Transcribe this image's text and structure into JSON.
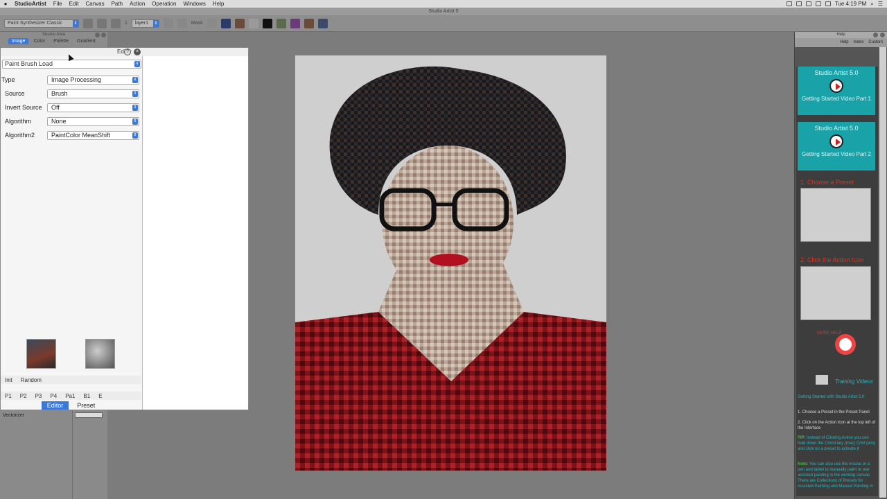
{
  "menubar": {
    "app": "StudioArtist",
    "items": [
      "File",
      "Edit",
      "Canvas",
      "Path",
      "Action",
      "Operation",
      "Windows",
      "Help"
    ],
    "clock": "Tue 4:19 PM"
  },
  "window": {
    "title": "Studio Artist 5"
  },
  "toolbar": {
    "preset_select": "Paint Synthesizer Classic",
    "layer_num": "1",
    "layer_select": "layer1",
    "mask_label": "Mask"
  },
  "source_area": {
    "title": "Source Area",
    "tabs": [
      "Image",
      "Color",
      "Palette",
      "Gradient"
    ],
    "active_tab": "Image"
  },
  "editor": {
    "title": "Editor",
    "main_select": "Paint Brush Load",
    "params": [
      {
        "label": "Type",
        "value": "Image Processing"
      },
      {
        "label": "Source",
        "value": "Brush"
      },
      {
        "label": "Invert Source",
        "value": "Off"
      },
      {
        "label": "Algorithm",
        "value": "None"
      },
      {
        "label": "Algorithm2",
        "value": "PaintColor MeanShift"
      }
    ],
    "init_row": [
      "Init",
      "Random"
    ],
    "preset_row": [
      "P1",
      "P2",
      "P3",
      "P4",
      "Pa1",
      "B1",
      "E"
    ],
    "tabs": [
      "Editor",
      "Preset"
    ],
    "active_tab": "Editor"
  },
  "vectorizer": {
    "label": "Vectorizer"
  },
  "help": {
    "title": "Help",
    "nav": [
      "Help",
      "Index",
      "Custom"
    ],
    "videos": [
      {
        "title": "Studio Artist 5.0",
        "subtitle": "Getting Started Video Part 1"
      },
      {
        "title": "Studio Artist 5.0",
        "subtitle": "Getting Started Video Part 2"
      }
    ],
    "steps": [
      {
        "title": "1. Choose a Preset"
      },
      {
        "title": "2. Click the Action Icon"
      }
    ],
    "more_help": "MORE HELP",
    "training": "Training Videos",
    "text": {
      "heading": "Getting Started with Studio Artist 5.0",
      "line1": "1. Choose a Preset in the Preset Panel",
      "line2": "2. Click on the Action Icon at the top left of the Interface",
      "tip_label": "TIP:",
      "tip": "Instead of Clicking Action you can hold down the Cmnd key (mac) Cntrl (win) and click on a preset to activate it",
      "note_label": "Note:",
      "note": "You can also use the mouse or a pen and tablet to manually paint or use assisted painting in the working canvas. There are Collections of Presets for Assisted Painting and Manual Painting in"
    }
  },
  "colors": {
    "accent": "#3b78d8",
    "help_teal": "#19a3a8",
    "help_red": "#d32f2f"
  }
}
